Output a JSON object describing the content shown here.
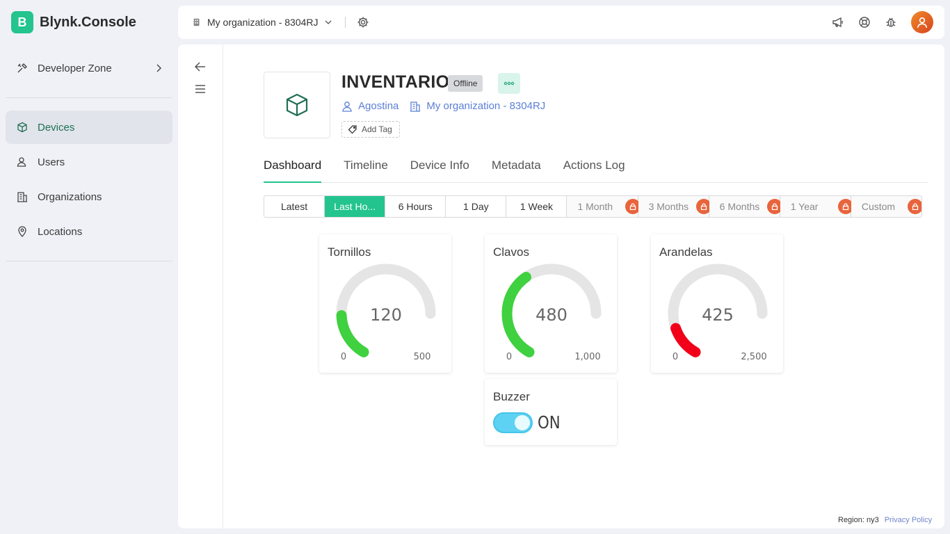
{
  "app": {
    "logo_letter": "B",
    "name": "Blynk.Console"
  },
  "sidebar": {
    "developer_zone": "Developer Zone",
    "items": [
      {
        "label": "Devices",
        "icon": "cube-icon",
        "active": true
      },
      {
        "label": "Users",
        "icon": "users-icon"
      },
      {
        "label": "Organizations",
        "icon": "building-icon"
      },
      {
        "label": "Locations",
        "icon": "pin-icon"
      }
    ]
  },
  "topbar": {
    "org_name": "My organization - 8304RJ"
  },
  "device": {
    "name": "INVENTARIO",
    "status": "Offline",
    "owner": "Agostina",
    "organization": "My organization - 8304RJ",
    "add_tag": "Add Tag"
  },
  "tabs": [
    "Dashboard",
    "Timeline",
    "Device Info",
    "Metadata",
    "Actions Log"
  ],
  "time_ranges": [
    {
      "label": "Latest"
    },
    {
      "label": "Last Ho...",
      "active": true
    },
    {
      "label": "6 Hours"
    },
    {
      "label": "1 Day"
    },
    {
      "label": "1 Week"
    },
    {
      "label": "1 Month",
      "locked": true
    },
    {
      "label": "3 Months",
      "locked": true
    },
    {
      "label": "6 Months",
      "locked": true
    },
    {
      "label": "1 Year",
      "locked": true
    },
    {
      "label": "Custom",
      "locked": true
    }
  ],
  "gauges": [
    {
      "title": "Tornillos",
      "value": "120",
      "min": "0",
      "max": "500",
      "fraction": 0.24,
      "color": "#3fd13f"
    },
    {
      "title": "Clavos",
      "value": "480",
      "min": "0",
      "max": "1,000",
      "fraction": 0.48,
      "color": "#3fd13f"
    },
    {
      "title": "Arandelas",
      "value": "425",
      "min": "0",
      "max": "2,500",
      "fraction": 0.17,
      "color": "#f2001a"
    }
  ],
  "buzzer": {
    "title": "Buzzer",
    "state": "ON"
  },
  "footer": {
    "region": "Region: ny3",
    "privacy": "Privacy Policy"
  },
  "colors": {
    "accent": "#23c48e",
    "link": "#5a7fd6",
    "lock": "#e8643c"
  }
}
